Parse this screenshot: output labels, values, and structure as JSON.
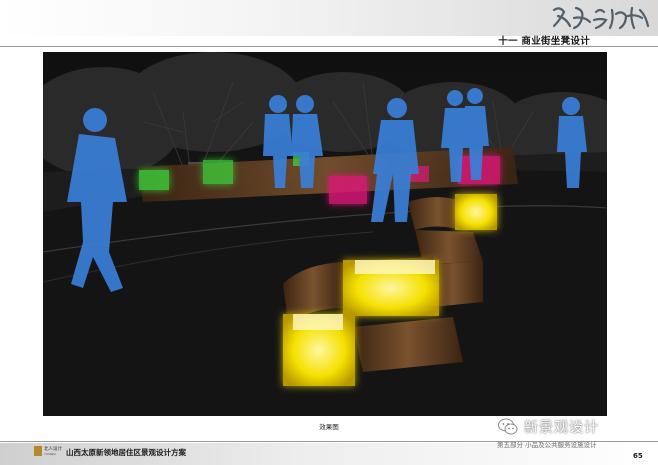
{
  "header": {
    "section_title": "十一 商业街坐凳设计"
  },
  "figure": {
    "caption": "效果图"
  },
  "footer": {
    "company_name": "北人设计",
    "company_name_en": "YUANJIA",
    "project_title": "山西太原新领地居住区景观设计方案",
    "part_title": "第五部分 小品及公共服务设施设计",
    "page_number": "65"
  },
  "watermark": {
    "text": "新景观设计",
    "icon": "wechat-icon"
  },
  "colors": {
    "bench_glow_yellow": "#f5e000",
    "bench_glow_green": "#3cdc3c",
    "bench_glow_magenta": "#e0187a",
    "bench_wood": "#6b4526",
    "figure_blue": "#3a7fd8",
    "night_background": "#0e0e0e"
  }
}
